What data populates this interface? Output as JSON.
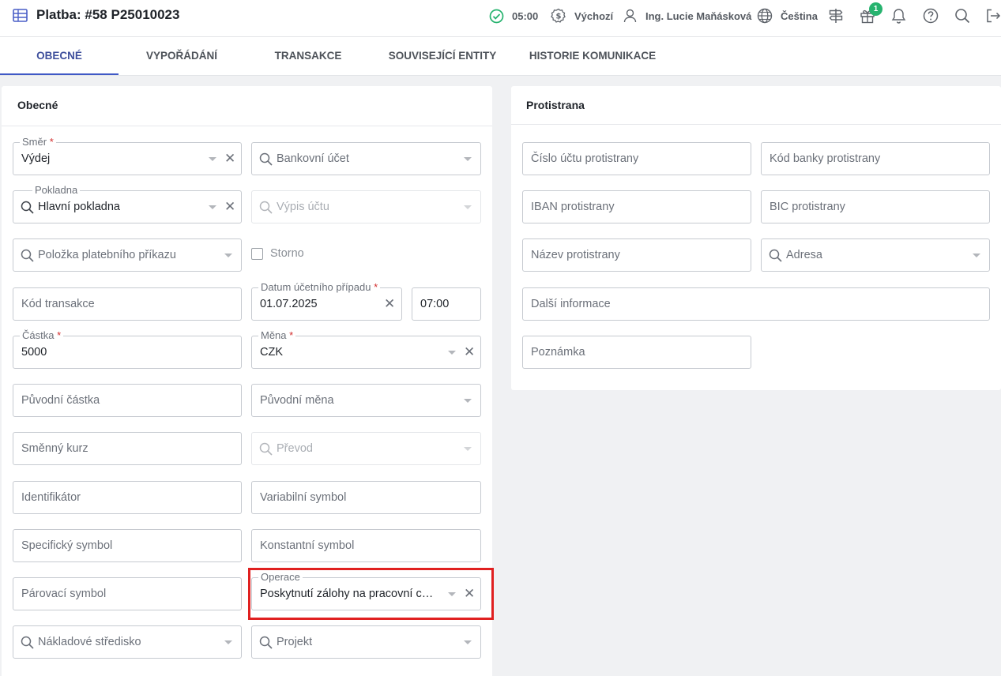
{
  "header": {
    "title": "Platba: #58 P25010023",
    "time": "05:00",
    "scenario": "Výchozí",
    "user": "Ing. Lucie Maňásková",
    "language": "Čeština",
    "gift_count": "1",
    "icons": [
      "table-icon",
      "check-circle-icon",
      "dollar-badge-icon",
      "user-icon",
      "globe-icon",
      "signpost-icon",
      "gift-icon",
      "bell-icon",
      "help-icon",
      "search-icon",
      "logout-icon"
    ]
  },
  "tabs": [
    {
      "label": "OBECNÉ",
      "active": true
    },
    {
      "label": "VYPOŘÁDÁNÍ"
    },
    {
      "label": "TRANSAKCE"
    },
    {
      "label": "SOUVISEJÍCÍ ENTITY"
    },
    {
      "label": "HISTORIE KOMUNIKACE"
    }
  ],
  "general": {
    "title": "Obecné",
    "smer": {
      "label": "Směr",
      "value": "Výdej"
    },
    "bankovni_ucet": {
      "placeholder": "Bankovní účet"
    },
    "pokladna": {
      "label": "Pokladna",
      "value": "Hlavní pokladna"
    },
    "vypis_uctu": {
      "placeholder": "Výpis účtu"
    },
    "polozka": {
      "placeholder": "Položka platebního příkazu"
    },
    "storno": {
      "label": "Storno"
    },
    "kod_transakce": {
      "placeholder": "Kód transakce"
    },
    "datum": {
      "label": "Datum účetního případu",
      "value": "01.07.2025"
    },
    "cas": {
      "value": "07:00"
    },
    "castka": {
      "label": "Částka",
      "value": "5000"
    },
    "mena": {
      "label": "Měna",
      "value": "CZK"
    },
    "puvodni_castka": {
      "placeholder": "Původní částka"
    },
    "puvodni_mena": {
      "placeholder": "Původní měna"
    },
    "smenny_kurz": {
      "placeholder": "Směnný kurz"
    },
    "prevod": {
      "placeholder": "Převod"
    },
    "identifikator": {
      "placeholder": "Identifikátor"
    },
    "variabilni_symbol": {
      "placeholder": "Variabilní symbol"
    },
    "specificky_symbol": {
      "placeholder": "Specifický symbol"
    },
    "konstantni_symbol": {
      "placeholder": "Konstantní symbol"
    },
    "parovaci_symbol": {
      "placeholder": "Párovací symbol"
    },
    "operace": {
      "label": "Operace",
      "value": "Poskytnutí zálohy na pracovní cestu"
    },
    "nakladove_stredisko": {
      "placeholder": "Nákladové středisko"
    },
    "projekt": {
      "placeholder": "Projekt"
    }
  },
  "counterparty": {
    "title": "Protistrana",
    "cislo_uctu": {
      "placeholder": "Číslo účtu protistrany"
    },
    "kod_banky": {
      "placeholder": "Kód banky protistrany"
    },
    "iban": {
      "placeholder": "IBAN protistrany"
    },
    "bic": {
      "placeholder": "BIC protistrany"
    },
    "nazev": {
      "placeholder": "Název protistrany"
    },
    "adresa": {
      "placeholder": "Adresa"
    },
    "dalsi_informace": {
      "placeholder": "Další informace"
    },
    "poznamka": {
      "placeholder": "Poznámka"
    }
  },
  "colors": {
    "accent": "#4059c6",
    "success": "#27b36f",
    "highlight": "#e02020",
    "required": "#d32f2f"
  }
}
